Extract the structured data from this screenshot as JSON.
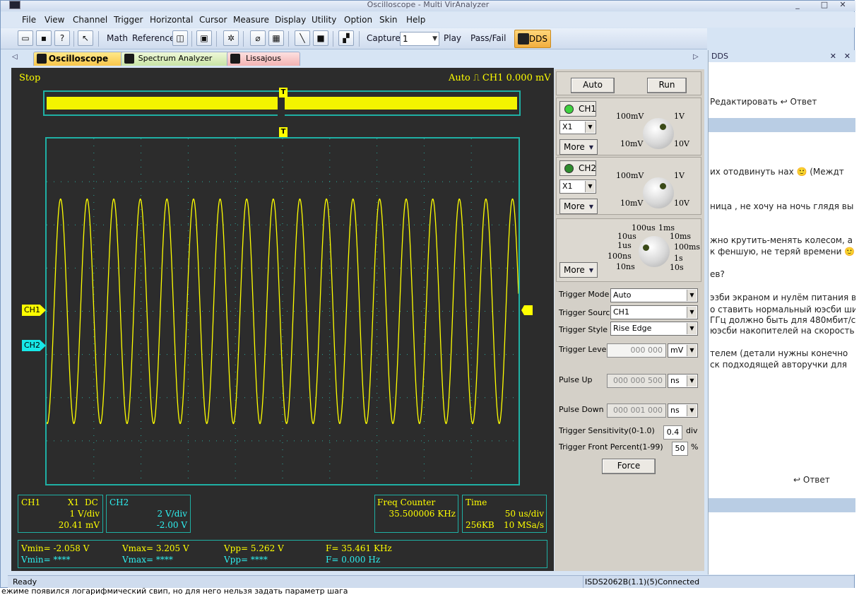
{
  "window": {
    "title": "Oscilloscope - Multi VirAnalyzer",
    "controls": [
      "_",
      "□",
      "✕"
    ]
  },
  "menu": [
    "File",
    "View",
    "Channel",
    "Trigger",
    "Horizontal",
    "Cursor",
    "Measure",
    "Display",
    "Utility",
    "Option",
    "Skin",
    "Help"
  ],
  "toolbar": {
    "math_label": "Math",
    "reference_label": "Reference",
    "capture_label": "Capture",
    "capture_value": "1",
    "play_label": "Play",
    "passfail_label": "Pass/Fail",
    "dds_label": "DDS"
  },
  "tabs": [
    {
      "label": "Oscilloscope"
    },
    {
      "label": "Spectrum Analyzer"
    },
    {
      "label": "Lissajous"
    }
  ],
  "scope": {
    "status": "Stop",
    "trigger_mode": "Auto",
    "trigger_channel": "CH1",
    "trigger_level": "0.000 mV",
    "marker_t": "T",
    "ch1_marker": "CH1",
    "ch2_marker": "CH2",
    "waveform": {
      "cycles": 17.75,
      "amplitude_div": 2.6,
      "offset_div": 0.0,
      "grid_x_div": 10,
      "grid_y_div": 8,
      "color": "#ffff00"
    },
    "ch1_box": {
      "name": "CH1",
      "probe": "X1",
      "coupling": "DC",
      "scale": "1 V/div",
      "offset": "20.41 mV"
    },
    "ch2_box": {
      "name": "CH2",
      "scale": "2 V/div",
      "offset": "-2.00 V"
    },
    "freq_box": {
      "title": "Freq Counter",
      "value": "35.500006 KHz"
    },
    "time_box": {
      "title": "Time",
      "scale": "50 us/div",
      "memory": "256KB",
      "rate": "10 MSa/s"
    },
    "measure": {
      "ch1": {
        "vmin": "Vmin= -2.058 V",
        "vmax": "Vmax= 3.205 V",
        "vpp": "Vpp= 5.262 V",
        "freq": "F= 35.461 KHz"
      },
      "ch2": {
        "vmin": "Vmin= ****",
        "vmax": "Vmax= ****",
        "vpp": "Vpp= ****",
        "freq": "F= 0.000 Hz"
      }
    }
  },
  "control": {
    "auto_label": "Auto",
    "run_label": "Run",
    "ch1": {
      "label": "CH1",
      "probe": "X1",
      "more": "More",
      "led_color": "#3fd13f",
      "knob_labels": {
        "tl": "100mV",
        "tr": "1V",
        "bl": "10mV",
        "br": "10V"
      }
    },
    "ch2": {
      "label": "CH2",
      "probe": "X1",
      "more": "More",
      "led_color": "#2e8b2e",
      "knob_labels": {
        "tl": "100mV",
        "tr": "1V",
        "bl": "10mV",
        "br": "10V"
      }
    },
    "timebase": {
      "more": "More",
      "labels": [
        "100us",
        "1ms",
        "10us",
        "10ms",
        "1us",
        "100ms",
        "100ns",
        "1s",
        "10ns",
        "10s"
      ]
    },
    "trigger": {
      "mode_label": "Trigger Mode",
      "mode_value": "Auto",
      "source_label": "Trigger Source",
      "source_value": "CH1",
      "style_label": "Trigger Style",
      "style_value": "Rise Edge",
      "level_label": "Trigger Level",
      "level_value": "000 000",
      "level_unit": "mV",
      "pulse_up_label": "Pulse Up",
      "pulse_up_value": "000 000 500",
      "pulse_up_unit": "ns",
      "pulse_down_label": "Pulse Down",
      "pulse_down_value": "000 001 000",
      "pulse_down_unit": "ns",
      "sensitivity_label": "Trigger Sensitivity(0-1.0)",
      "sensitivity_value": "0.4",
      "sensitivity_unit": "div",
      "front_label": "Trigger Front Percent(1-99)",
      "front_value": "50",
      "front_unit": "%",
      "force_label": "Force"
    }
  },
  "dds_panel": {
    "title": "DDS",
    "bg_lines": [
      "Редактировать      ↩ Ответ",
      "их отодвинуть нах 🙂 (Междт",
      "ница , не хочу на ночь глядя вы",
      "жно крутить-менять колесом, а",
      "к феншую, не теряй времени 🙂",
      "ев?",
      "эзби экраном и нулём питания ва",
      "о ставить нормальный юэсби ши",
      "ГГц должно быть для 480мбит/с",
      "юэсби накопителей на скорость",
      "телем (детали нужны конечно",
      "ск подходящей авторучки для",
      "↩ Ответ"
    ]
  },
  "bg_bottom_text": "ежиме появился логарифмический свип, но для него нельзя задать параметр шага",
  "statusbar": {
    "left": "Ready",
    "right": "ISDS2062B(1.1)(5)Connected"
  }
}
